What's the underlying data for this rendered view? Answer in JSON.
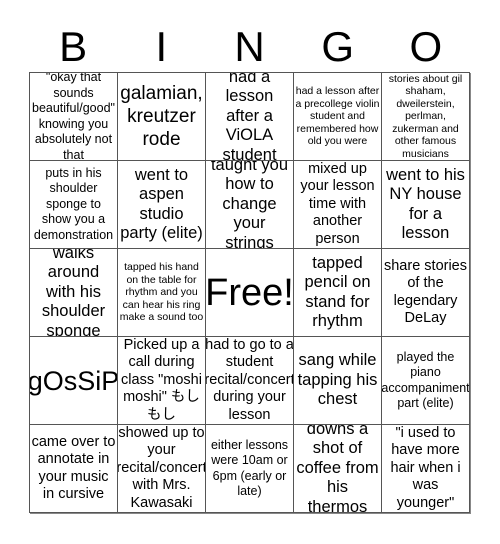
{
  "header": {
    "letters": [
      "B",
      "I",
      "N",
      "G",
      "O"
    ]
  },
  "board": {
    "rows": [
      [
        "\"okay that sounds beautiful/good\" knowing you absolutely not that",
        "galamian, kreutzer rode",
        "had a lesson after a ViOLA student",
        "had a lesson after a precollege violin student and remembered how old you were",
        "stories about gil shaham, dweilerstein, perlman, zukerman and other famous musicians"
      ],
      [
        "puts in his shoulder sponge to show you a demonstration",
        "went to aspen studio party (elite)",
        "taught you how to change your strings",
        "mixed up your lesson time with another person",
        "went to his NY house for a lesson"
      ],
      [
        "walks around with his shoulder sponge",
        "tapped his hand on the table for rhythm and you can hear his ring make a sound too",
        "Free!",
        "tapped pencil on stand for rhythm",
        "share stories of the legendary DeLay"
      ],
      [
        "gOsSiP",
        "Picked up a call during class \"moshi moshi\" もしもし",
        "had to go to a student recital/concert during your lesson",
        "sang while tapping his chest",
        "played the piano accompaniment part (elite)"
      ],
      [
        "came over to annotate in your music in cursive",
        "showed up to your recital/concert with Mrs. Kawasaki",
        "either lessons were 10am or 6pm (early or late)",
        "downs a shot of coffee from his thermos",
        "\"i used to have more hair when i was younger\""
      ]
    ]
  }
}
